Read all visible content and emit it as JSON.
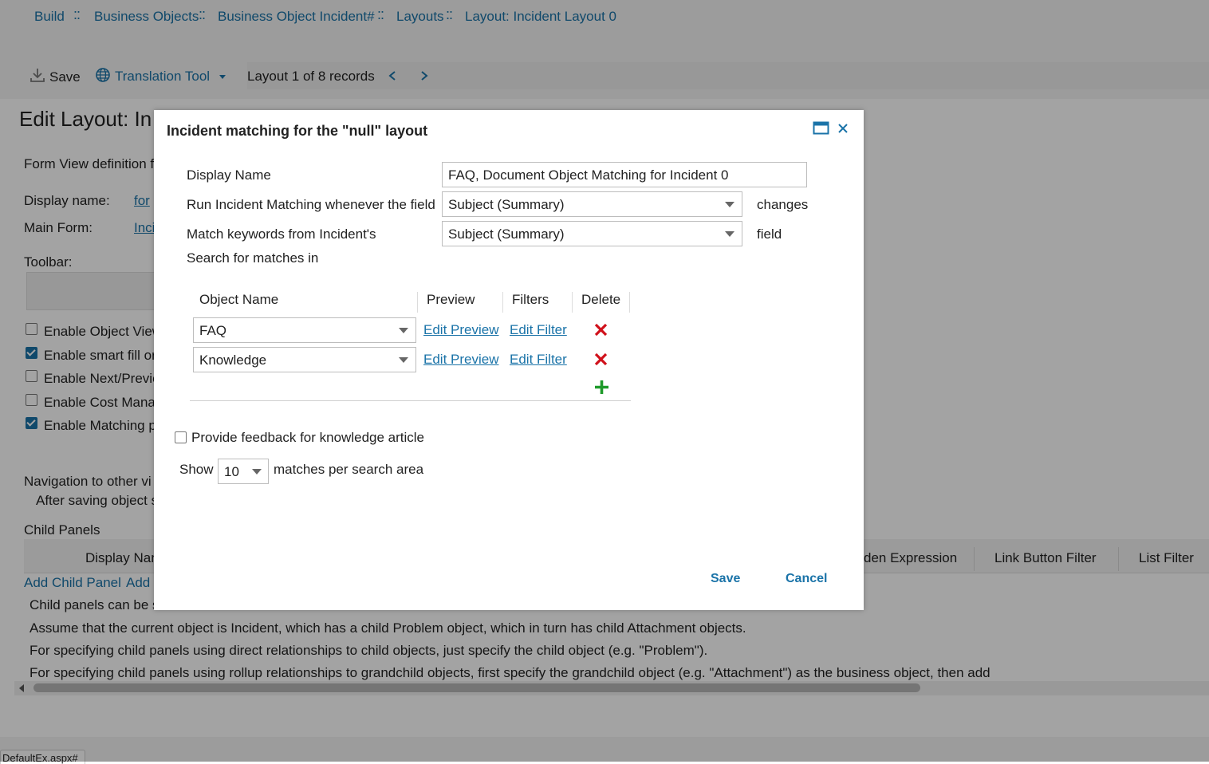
{
  "breadcrumb": {
    "items": [
      "Build",
      "Business Objects",
      "Business Object Incident#",
      "Layouts",
      "Layout: Incident Layout 0"
    ],
    "separator": "::"
  },
  "toolbar": {
    "save_label": "Save",
    "translation_label": "Translation Tool",
    "record_label": "Layout 1 of 8 records",
    "prev_icon": "chevron-left-icon",
    "next_icon": "chevron-right-icon"
  },
  "page": {
    "title": "Edit Layout: In",
    "form_view_label": "Form View definition f",
    "display_name_label": "Display name:",
    "display_name_value": "for",
    "main_form_label": "Main Form:",
    "main_form_value": "Inci",
    "toolbar_label": "Toolbar:",
    "checkboxes": [
      {
        "label": "Enable Object View",
        "checked": false
      },
      {
        "label": "Enable smart fill or",
        "checked": true
      },
      {
        "label": "Enable Next/Previo",
        "checked": false
      },
      {
        "label": "Enable Cost Manag",
        "checked": false
      },
      {
        "label": "Enable Matching p",
        "checked": true
      }
    ],
    "navigation_label": "Navigation to other vi",
    "after_saving_label": "After saving object s",
    "child_panels_label": "Child Panels",
    "child_columns": [
      "Display Nan",
      "den Expression",
      "Link Button Filter",
      "List Filter"
    ],
    "add_child_panel": "Add Child Panel",
    "add_link": "Add",
    "notes": [
      "Child panels can be s",
      "Assume that the current object is Incident, which has a child Problem object, which in turn has child Attachment objects.",
      "For specifying child panels using direct relationships to child objects, just specify the child object (e.g. \"Problem\").",
      "For specifying child panels using rollup relationships to grandchild objects, first specify the grandchild object (e.g. \"Attachment\") as the business object, then add"
    ],
    "status_tab": "DefaultEx.aspx#"
  },
  "dialog": {
    "title": "Incident matching for the \"null\" layout",
    "display_name_label": "Display Name",
    "display_name_value": "FAQ, Document Object Matching for Incident 0",
    "run_label": "Run Incident Matching whenever the field",
    "run_field_value": "Subject (Summary)",
    "run_suffix": "changes",
    "keywords_label": "Match keywords from Incident's",
    "keywords_field_value": "Subject (Summary)",
    "keywords_suffix": "field",
    "search_label": "Search for matches in",
    "table_headers": [
      "Object Name",
      "Preview",
      "Filters",
      "Delete"
    ],
    "rows": [
      {
        "object": "FAQ",
        "preview": "Edit Preview",
        "filter": "Edit Filter"
      },
      {
        "object": "Knowledge",
        "preview": "Edit Preview",
        "filter": "Edit Filter"
      }
    ],
    "feedback_label": "Provide feedback for knowledge article",
    "feedback_checked": false,
    "show_label": "Show",
    "show_value": "10",
    "show_suffix": "matches per search area",
    "save_label": "Save",
    "cancel_label": "Cancel"
  },
  "colors": {
    "link": "#1a73a8",
    "delete": "#d0111b",
    "add": "#1e9a2a",
    "overlay": "rgba(0,0,0,0.36)"
  }
}
